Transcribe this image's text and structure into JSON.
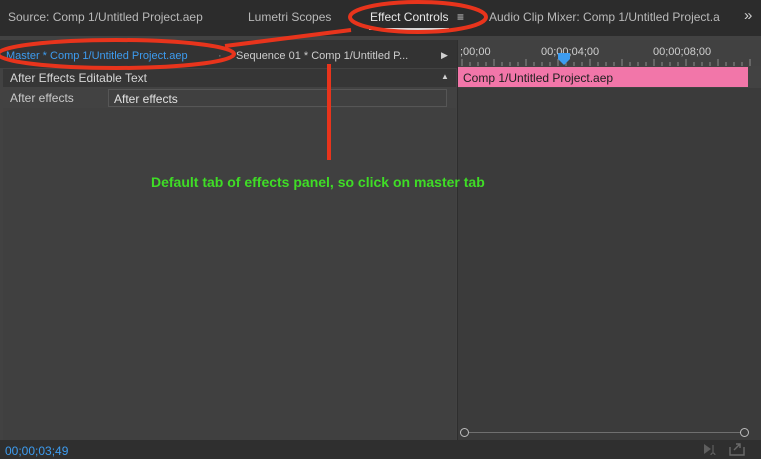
{
  "tabs": {
    "source": "Source: Comp 1/Untitled Project.aep",
    "lumetri": "Lumetri Scopes",
    "effect_controls": "Effect Controls",
    "effect_controls_menu": "≡",
    "audio_mixer": "Audio Clip Mixer: Comp 1/Untitled Project.a",
    "overflow": "»"
  },
  "subtabs": {
    "master": "Master * Comp 1/Untitled Project.aep",
    "separator": "·",
    "sequence": "Sequence 01 * Comp 1/Untitled P...",
    "arrow": "▶"
  },
  "section": {
    "title": "After Effects Editable Text",
    "toggle": "▲"
  },
  "property": {
    "label": "After effects",
    "value": "After effects"
  },
  "timeline": {
    "ruler_labels": [
      ";00;00",
      "00;00;04;00",
      "00;00;08;00"
    ],
    "clip_label": "Comp 1/Untitled Project.aep"
  },
  "footer": {
    "timecode": "00;00;03;49"
  },
  "annotation": {
    "text": "Default tab of effects panel, so click on master tab"
  },
  "colors": {
    "accent_blue": "#3d9cf0",
    "clip_pink": "#f276a9",
    "annotation_red": "#e8341c",
    "annotation_green": "#3fdd26"
  },
  "icons": {
    "playhead": "playhead-icon",
    "tab_menu": "hamburger-menu-icon",
    "overflow": "double-chevron-right-icon",
    "export": "export-frame-icon",
    "playback": "play-audio-icon"
  }
}
